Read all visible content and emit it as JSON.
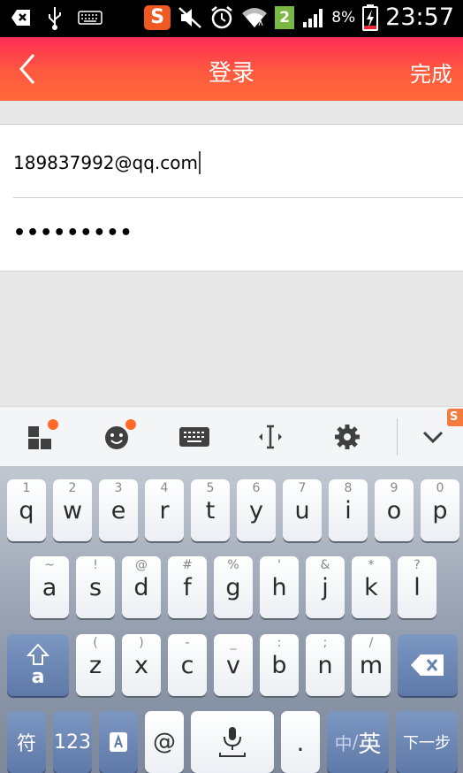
{
  "status_bar": {
    "time": "23:57",
    "battery_percent": "8%",
    "notification_count": "2",
    "sogou_label": "S",
    "icons": [
      "add-notification-icon",
      "usb-icon",
      "keyboard-icon",
      "sogou-icon",
      "mute-icon",
      "alarm-icon",
      "wifi-icon",
      "signal-icon",
      "battery-charging-icon"
    ]
  },
  "header": {
    "title": "登录",
    "done_label": "完成",
    "gradient_top": "#ff2d55",
    "gradient_bottom": "#ff6a3a"
  },
  "form": {
    "email_value": "189837992@qq.com",
    "password_value": "•••••••••"
  },
  "keyboard_toolbar": {
    "icons": [
      "apps-icon",
      "emoji-icon",
      "keyboard-icon",
      "cursor-icon",
      "settings-icon",
      "collapse-chevron-icon"
    ],
    "sogou_peek_label": "S"
  },
  "keyboard": {
    "row1": [
      {
        "hint": "1",
        "key": "q"
      },
      {
        "hint": "2",
        "key": "w"
      },
      {
        "hint": "3",
        "key": "e"
      },
      {
        "hint": "4",
        "key": "r"
      },
      {
        "hint": "5",
        "key": "t"
      },
      {
        "hint": "6",
        "key": "y"
      },
      {
        "hint": "7",
        "key": "u"
      },
      {
        "hint": "8",
        "key": "i"
      },
      {
        "hint": "9",
        "key": "o"
      },
      {
        "hint": "0",
        "key": "p"
      }
    ],
    "row2": [
      {
        "hint": "~",
        "key": "a"
      },
      {
        "hint": "!",
        "key": "s"
      },
      {
        "hint": "@",
        "key": "d"
      },
      {
        "hint": "#",
        "key": "f"
      },
      {
        "hint": "%",
        "key": "g"
      },
      {
        "hint": "'",
        "key": "h"
      },
      {
        "hint": "&",
        "key": "j"
      },
      {
        "hint": "*",
        "key": "k"
      },
      {
        "hint": "?",
        "key": "l"
      }
    ],
    "row3": [
      {
        "hint": "(",
        "key": "z"
      },
      {
        "hint": ")",
        "key": "x"
      },
      {
        "hint": "-",
        "key": "c"
      },
      {
        "hint": "_",
        "key": "v"
      },
      {
        "hint": ":",
        "key": "b"
      },
      {
        "hint": ";",
        "key": "n"
      },
      {
        "hint": "/",
        "key": "m"
      }
    ],
    "shift_label": "a",
    "symbols_label": "符",
    "numbers_label": "123",
    "at_label": "@",
    "period_label": ".",
    "lang_label_zh": "中",
    "lang_label_sep": "/",
    "lang_label_en": "英",
    "next_label": "下一步",
    "accent_dark": "#6a84b3"
  }
}
